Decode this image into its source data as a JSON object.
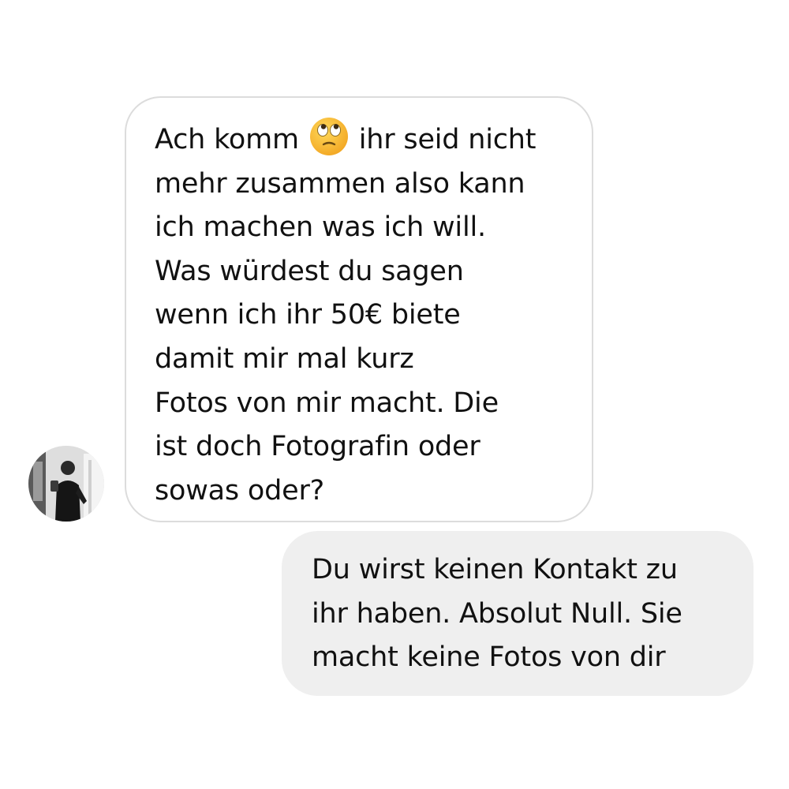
{
  "conversation": {
    "incoming_message": {
      "text_before_emoji": "Ach komm",
      "emoji": "face-with-rolling-eyes-icon",
      "text_after_emoji": "ihr seid nicht\nmehr zusammen also kann\nich machen was ich will.\nWas würdest du sagen\nwenn ich ihr 50€ biete\ndamit mir mal kurz\nFotos von mir macht. Die\nist doch Fotografin oder\nsowas oder?"
    },
    "outgoing_message": {
      "text": "Du wirst keinen Kontakt zu\nihr haben. Absolut Null. Sie\nmacht keine Fotos von dir"
    },
    "sender_avatar": "person-photo-avatar"
  },
  "colors": {
    "incoming_bubble_border": "#dcdcdc",
    "outgoing_bubble_bg": "#efefef",
    "text": "#111111",
    "emoji_face": "#f7c13a"
  }
}
